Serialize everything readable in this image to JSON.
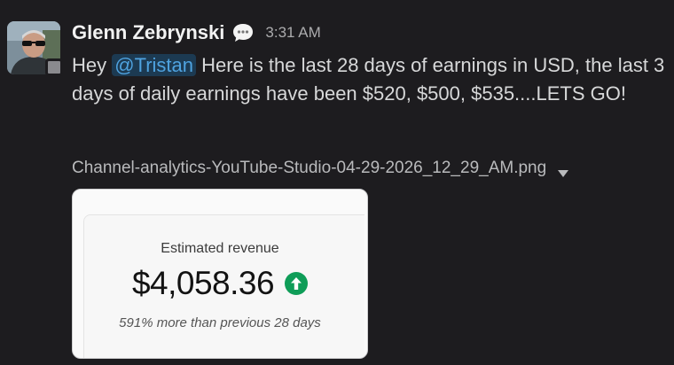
{
  "message": {
    "author": "Glenn Zebrynski",
    "status_emoji": "speech-bubble-icon",
    "timestamp": "3:31 AM",
    "text_before_mention": "Hey ",
    "mention": "@Tristan",
    "text_after_mention": " Here is the last 28 days of earnings in USD, the last 3 days of daily earnings have been $520, $500, $535....LETS GO!",
    "presence": "away"
  },
  "attachment": {
    "filename": "Channel-analytics-YouTube-Studio-04-29-2026_12_29_AM.png",
    "preview": {
      "title": "Estimated revenue",
      "value": "$4,058.36",
      "trend": "up",
      "trend_color": "#0f9d58",
      "note": "591% more than previous 28 days"
    }
  },
  "colors": {
    "background": "#1d1c1f",
    "mention_bg": "#1c3a52",
    "mention_text": "#4fa3e0"
  }
}
